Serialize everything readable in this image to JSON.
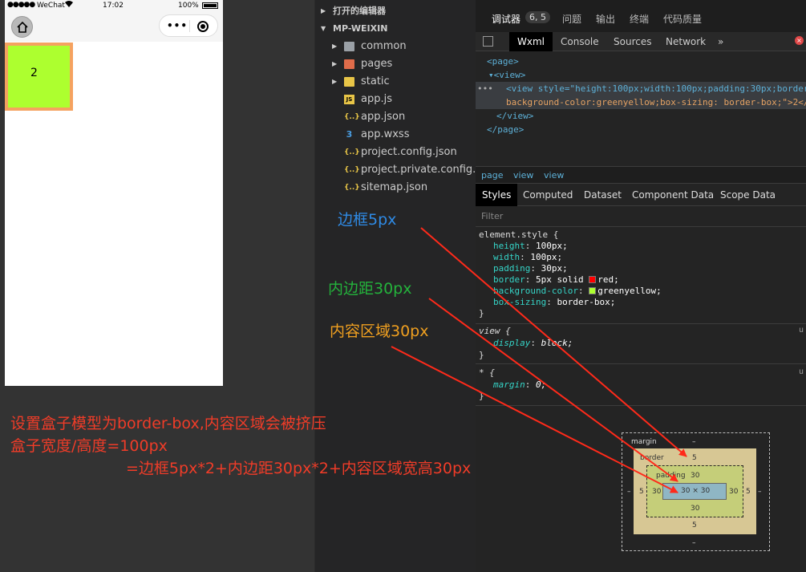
{
  "phone": {
    "status": {
      "signal": "●●●●●",
      "carrier": "WeChat",
      "time": "17:02",
      "battery": "100%"
    },
    "capsule_more": "•••",
    "demo_box_text": "2"
  },
  "explorer": {
    "open_editors": "打开的编辑器",
    "project": "MP-WEIXIN",
    "files": [
      {
        "name": "common",
        "icon": "folder-icon"
      },
      {
        "name": "pages",
        "icon": "folder-icon"
      },
      {
        "name": "static",
        "icon": "folder-icon"
      },
      {
        "name": "app.js",
        "icon": "js-file-icon"
      },
      {
        "name": "app.json",
        "icon": "json-file-icon"
      },
      {
        "name": "app.wxss",
        "icon": "css-file-icon"
      },
      {
        "name": "project.config.json",
        "icon": "json-file-icon"
      },
      {
        "name": "project.private.config.js...",
        "icon": "json-file-icon"
      },
      {
        "name": "sitemap.json",
        "icon": "json-file-icon"
      }
    ]
  },
  "devtools": {
    "top_tabs": [
      "调试器",
      "问题",
      "输出",
      "终端",
      "代码质量"
    ],
    "debugger_count": "6, 5",
    "tool_tabs": [
      "Wxml",
      "Console",
      "Sources",
      "Network",
      "»"
    ],
    "wxml": {
      "page_open": "<page>",
      "view_open": "<view>",
      "ellipsis": "•••",
      "selected_line1": "<view style=\"height:100px;width:100px;padding:30px;border",
      "selected_line2": "background-color:greenyellow;box-sizing: border-box;\">2</",
      "view_close": "</view>",
      "page_close": "</page>"
    },
    "breadcrumbs": [
      "page",
      "view",
      "view"
    ],
    "style_tabs": [
      "Styles",
      "Computed",
      "Dataset",
      "Component Data",
      "Scope Data"
    ],
    "filter_placeholder": "Filter",
    "element_style": {
      "selector": "element.style {",
      "props": [
        {
          "name": "height",
          "value": "100px;"
        },
        {
          "name": "width",
          "value": "100px;"
        },
        {
          "name": "padding",
          "value": "30px;"
        },
        {
          "name": "border",
          "value": "5px solid ",
          "color_value": "red;",
          "swatch": "#ff0000"
        },
        {
          "name": "background-color",
          "value": "",
          "color_value": "greenyellow;",
          "swatch": "#adff2f"
        },
        {
          "name": "box-sizing",
          "value": "border-box;"
        }
      ],
      "close": "}"
    },
    "view_rule": {
      "selector": "view {",
      "prop": "display",
      "value": "block;",
      "close": "}",
      "source": "u"
    },
    "star_rule": {
      "selector": "* {",
      "prop": "margin",
      "value": "0;",
      "close": "}",
      "source": "u"
    },
    "box_model": {
      "margin_label": "margin",
      "margin_value": "–",
      "border_label": "border",
      "border_value": "5",
      "padding_label": "padding",
      "padding_value": "30",
      "content": "30 × 30",
      "side_dash": "–",
      "bottom_margin": "–"
    }
  },
  "annotations": {
    "border": "边框5px",
    "padding": "内边距30px",
    "content": "内容区域30px",
    "summary1": "设置盒子模型为border-box,内容区域会被挤压",
    "summary2": "盒子宽度/高度=100px",
    "summary3": "=边框5px*2+内边距30px*2+内容区域宽高30px",
    "colors": {
      "border": "#2f8be6",
      "padding": "#24b33c",
      "content": "#f0a020",
      "summary": "#f03c28",
      "arrow": "#ff2a1a"
    }
  }
}
